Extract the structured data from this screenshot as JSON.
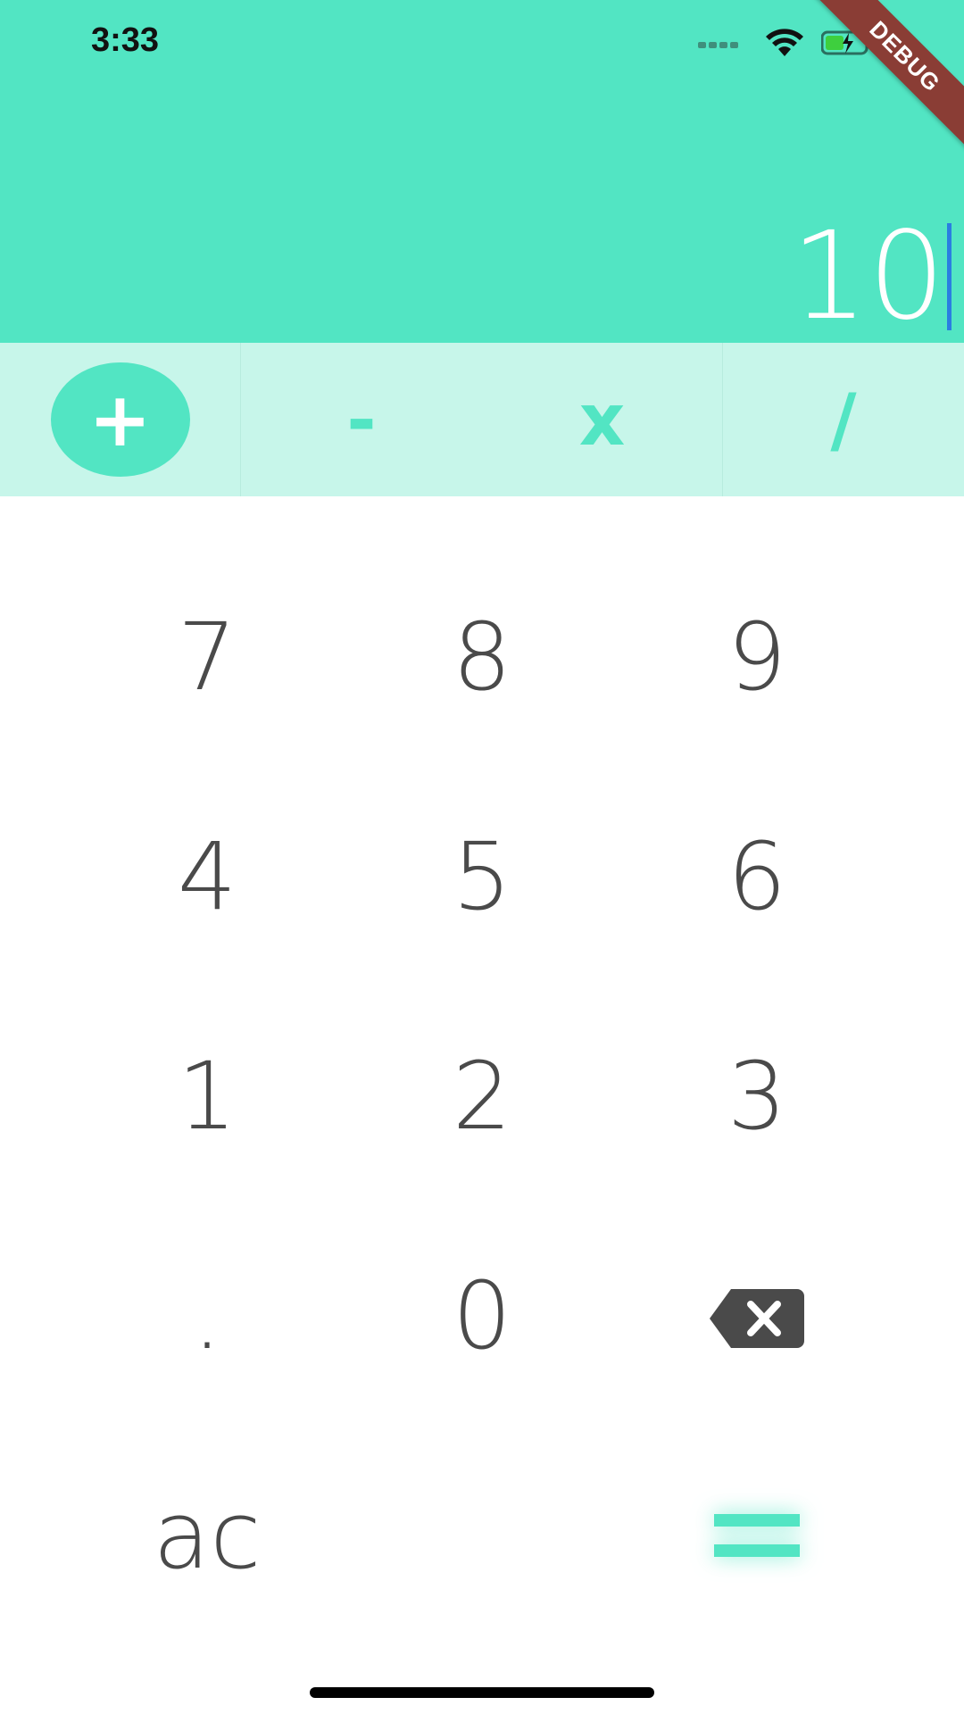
{
  "status_bar": {
    "time": "3:33"
  },
  "debug_banner": "DEBUG",
  "display": {
    "value": "10"
  },
  "operators": [
    {
      "label": "+",
      "selected": true
    },
    {
      "label": "-",
      "selected": false
    },
    {
      "label": "x",
      "selected": false
    },
    {
      "label": "/",
      "selected": false
    }
  ],
  "keypad": {
    "row1": [
      "7",
      "8",
      "9"
    ],
    "row2": [
      "4",
      "5",
      "6"
    ],
    "row3": [
      "1",
      "2",
      "3"
    ],
    "row4": [
      ".",
      "0"
    ],
    "clear_label": "ac"
  },
  "colors": {
    "accent": "#52E5C3",
    "accent_light": "#C7F6EA",
    "key_text": "#4A4A4A",
    "caret": "#2A7DE1",
    "debug_banner": "#8A3D35"
  },
  "icons": {
    "backspace": "backspace-icon",
    "equals": "equals-icon",
    "wifi": "wifi-icon",
    "battery": "battery-charging-icon",
    "signal": "signal-dots-icon"
  }
}
